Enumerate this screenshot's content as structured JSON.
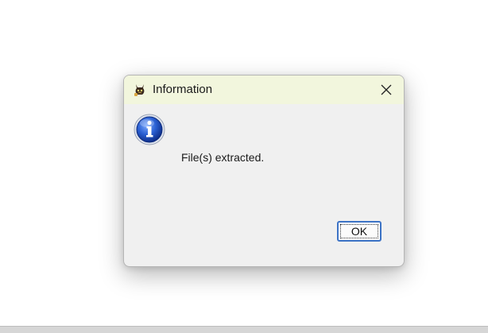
{
  "dialog": {
    "title": "Information",
    "message": "File(s) extracted.",
    "ok_label": "OK",
    "titlebar_color": "#f2f6dd",
    "body_color": "#f0f0f0",
    "accent_color": "#3c73c6"
  },
  "icons": {
    "app": "app-animal-icon",
    "close": "close-icon",
    "info": "information-icon"
  }
}
